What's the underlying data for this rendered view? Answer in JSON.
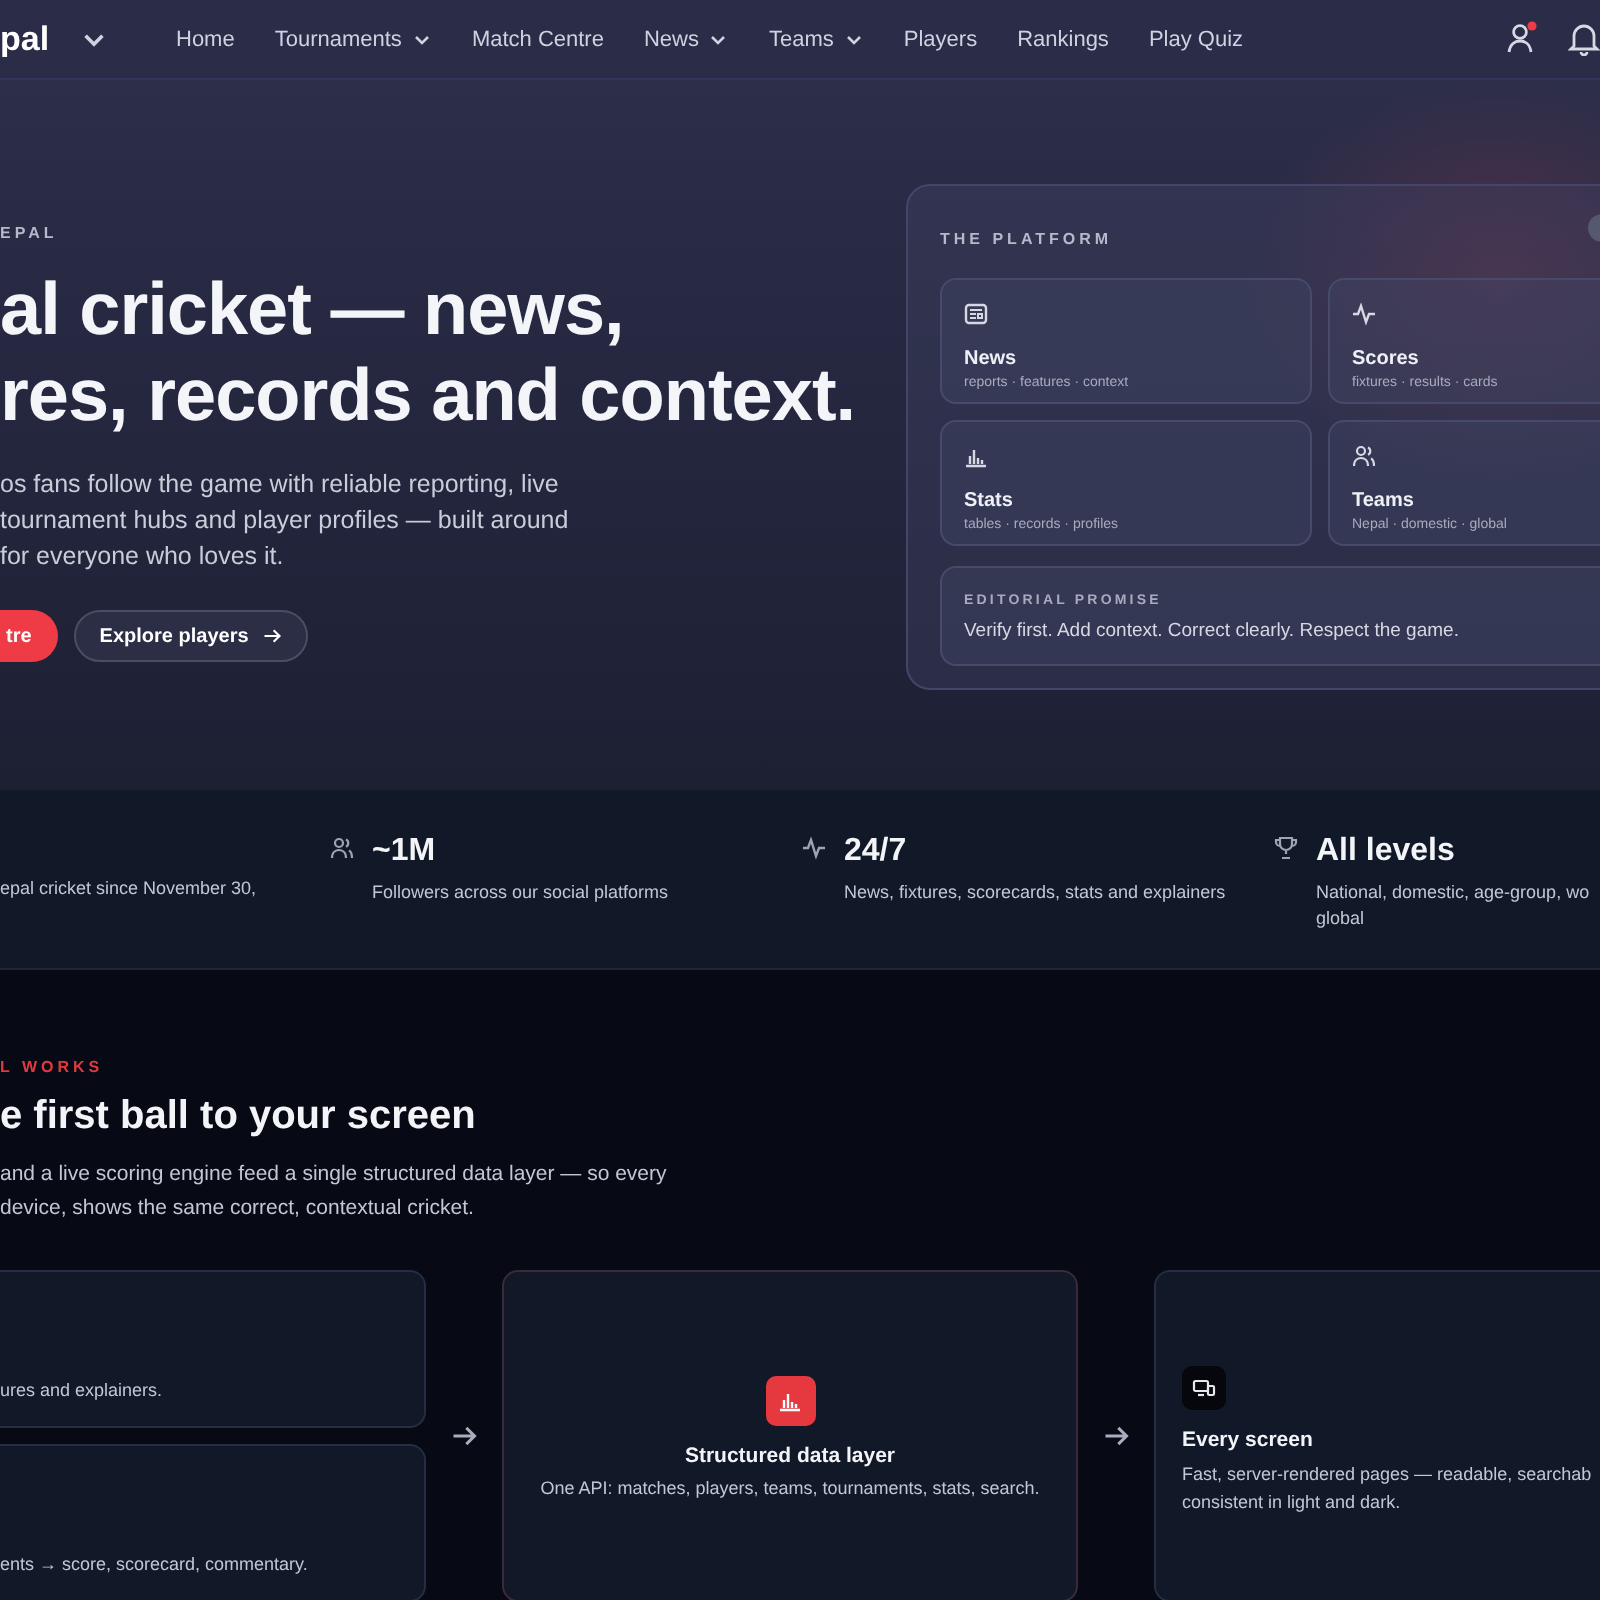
{
  "nav": {
    "logo": "pal",
    "links": [
      {
        "label": "Home",
        "dropdown": false
      },
      {
        "label": "Tournaments",
        "dropdown": true
      },
      {
        "label": "Match Centre",
        "dropdown": false
      },
      {
        "label": "News",
        "dropdown": true
      },
      {
        "label": "Teams",
        "dropdown": true
      },
      {
        "label": "Players",
        "dropdown": false
      },
      {
        "label": "Rankings",
        "dropdown": false
      },
      {
        "label": "Play Quiz",
        "dropdown": false
      }
    ]
  },
  "hero": {
    "eyebrow": "EPAL",
    "headline_lines": [
      "al cricket — news,",
      "res, records and context."
    ],
    "intro_lines": [
      "os fans follow the game with reliable reporting, live",
      "tournament hubs and player profiles — built around",
      "for everyone who loves it."
    ],
    "buttons": [
      {
        "label": "tre",
        "kind": "primary"
      },
      {
        "label": "Explore players",
        "kind": "secondary"
      }
    ]
  },
  "platform": {
    "title": "THE PLATFORM",
    "tiles": [
      {
        "title": "News",
        "subtitle": "reports · features · context"
      },
      {
        "title": "Scores",
        "subtitle": "fixtures · results · cards"
      },
      {
        "title": "Stats",
        "subtitle": "tables · records · profiles"
      },
      {
        "title": "Teams",
        "subtitle": "Nepal · domestic · global"
      }
    ],
    "promise": {
      "label": "EDITORIAL PROMISE",
      "text": "Verify first. Add context. Correct clearly. Respect the game."
    }
  },
  "stats": [
    {
      "text_lines": [
        "epal cricket since November 30,"
      ]
    },
    {
      "value": "~1M",
      "text_lines": [
        "Followers across our social platforms"
      ]
    },
    {
      "value": "24/7",
      "text_lines": [
        "News, fixtures, scorecards, stats and explainers"
      ]
    },
    {
      "value": "All levels",
      "text_lines": [
        "National, domestic, age-group, wo",
        "global"
      ]
    }
  ],
  "flow": {
    "eyebrow": "L WORKS",
    "heading": "e first ball to your screen",
    "intro_lines": [
      "and a live scoring engine feed a single structured data layer — so every",
      "device, shows the same correct, contextual cricket."
    ],
    "sources": [
      {
        "text": "ures and explainers."
      },
      {
        "text": "ents → score, scorecard, commentary."
      }
    ],
    "hub": {
      "title": "Structured data layer",
      "text": "One API: matches, players, teams, tournaments, stats, search."
    },
    "output": {
      "title": "Every screen",
      "text_lines": [
        "Fast, server-rendered pages — readable, searchab",
        "consistent in light and dark."
      ]
    }
  }
}
